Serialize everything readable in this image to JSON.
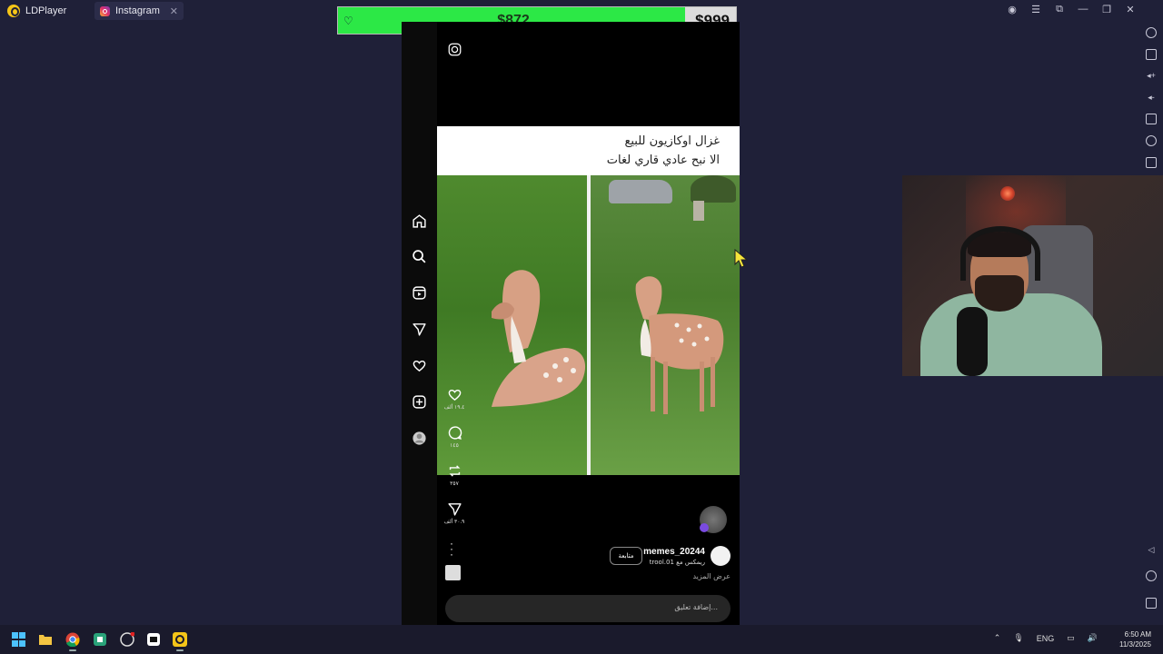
{
  "tabs": [
    {
      "label": "LDPlayer"
    },
    {
      "label": "Instagram"
    }
  ],
  "donation_goal": {
    "current": "$872",
    "target": "$999",
    "progress": 0.873,
    "fill_color": "#2ce846"
  },
  "reel": {
    "caption_line1": "غزال اوكازيون للبيع",
    "caption_line2": "الا نبح عادي قاري لغات",
    "likes": "١٩.٤ ألف",
    "comments": "١٤٥",
    "reposts": "٣٥٧",
    "shares": "٣٠.٩ ألف",
    "username": "memes_20244",
    "audio": "trool.01 ريمكس مع",
    "follow_label": "متابعة",
    "see_more": "عرض المزيد",
    "comment_placeholder": "إضافة تعليق..."
  },
  "taskbar": {
    "lang": "ENG",
    "time": "6:50 AM",
    "date": "11/3/2025"
  },
  "colors": {
    "background": "#1f2038",
    "accent": "#f5c518"
  }
}
